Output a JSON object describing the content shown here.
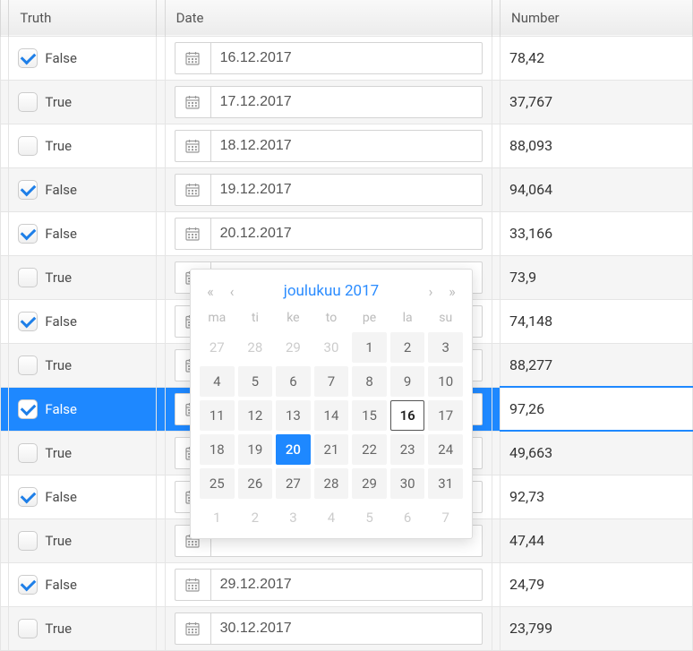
{
  "columns": {
    "truth": "Truth",
    "date": "Date",
    "number": "Number"
  },
  "rows": [
    {
      "checked": true,
      "truth": "False",
      "date": "16.12.2017",
      "number": "78,42",
      "alt": false,
      "selected": false
    },
    {
      "checked": false,
      "truth": "True",
      "date": "17.12.2017",
      "number": "37,767",
      "alt": true,
      "selected": false
    },
    {
      "checked": false,
      "truth": "True",
      "date": "18.12.2017",
      "number": "88,093",
      "alt": false,
      "selected": false
    },
    {
      "checked": true,
      "truth": "False",
      "date": "19.12.2017",
      "number": "94,064",
      "alt": true,
      "selected": false
    },
    {
      "checked": true,
      "truth": "False",
      "date": "20.12.2017",
      "number": "33,166",
      "alt": false,
      "selected": false
    },
    {
      "checked": false,
      "truth": "True",
      "date": "",
      "number": "73,9",
      "alt": true,
      "selected": false
    },
    {
      "checked": true,
      "truth": "False",
      "date": "",
      "number": "74,148",
      "alt": false,
      "selected": false
    },
    {
      "checked": false,
      "truth": "True",
      "date": "",
      "number": "88,277",
      "alt": true,
      "selected": false
    },
    {
      "checked": true,
      "truth": "False",
      "date": "",
      "number": "97,26",
      "alt": false,
      "selected": true
    },
    {
      "checked": false,
      "truth": "True",
      "date": "",
      "number": "49,663",
      "alt": true,
      "selected": false
    },
    {
      "checked": true,
      "truth": "False",
      "date": "",
      "number": "92,73",
      "alt": false,
      "selected": false
    },
    {
      "checked": false,
      "truth": "True",
      "date": "",
      "number": "47,44",
      "alt": true,
      "selected": false
    },
    {
      "checked": true,
      "truth": "False",
      "date": "29.12.2017",
      "number": "24,79",
      "alt": false,
      "selected": false
    },
    {
      "checked": false,
      "truth": "True",
      "date": "30.12.2017",
      "number": "23,799",
      "alt": true,
      "selected": false
    }
  ],
  "calendar": {
    "title": "joulukuu 2017",
    "weekdays": [
      "ma",
      "ti",
      "ke",
      "to",
      "pe",
      "la",
      "su"
    ],
    "today": 16,
    "selected": 20,
    "leading": [
      27,
      28,
      29,
      30
    ],
    "days": [
      1,
      2,
      3,
      4,
      5,
      6,
      7,
      8,
      9,
      10,
      11,
      12,
      13,
      14,
      15,
      16,
      17,
      18,
      19,
      20,
      21,
      22,
      23,
      24,
      25,
      26,
      27,
      28,
      29,
      30,
      31
    ],
    "trailing": [
      1,
      2,
      3,
      4,
      5,
      6,
      7
    ]
  }
}
